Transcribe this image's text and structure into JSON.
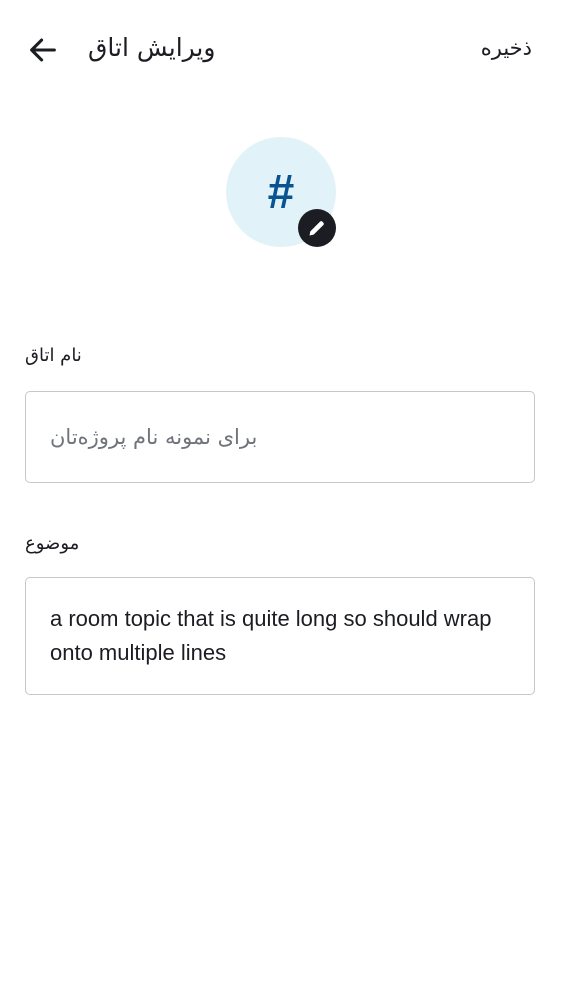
{
  "header": {
    "back_icon": "arrow-left-icon",
    "title": "ویرایش اتاق",
    "save_label": "ذخیره"
  },
  "avatar": {
    "glyph": "#",
    "edit_icon": "pencil-icon",
    "background": "#e1f3f8",
    "glyph_color": "#0a5392"
  },
  "form": {
    "name_label": "نام اتاق",
    "name_value": "",
    "name_placeholder": "برای نمونه نام پروژه‌تان",
    "topic_label": "موضوع",
    "topic_value": "a room topic that is quite long so should wrap onto multiple lines"
  }
}
